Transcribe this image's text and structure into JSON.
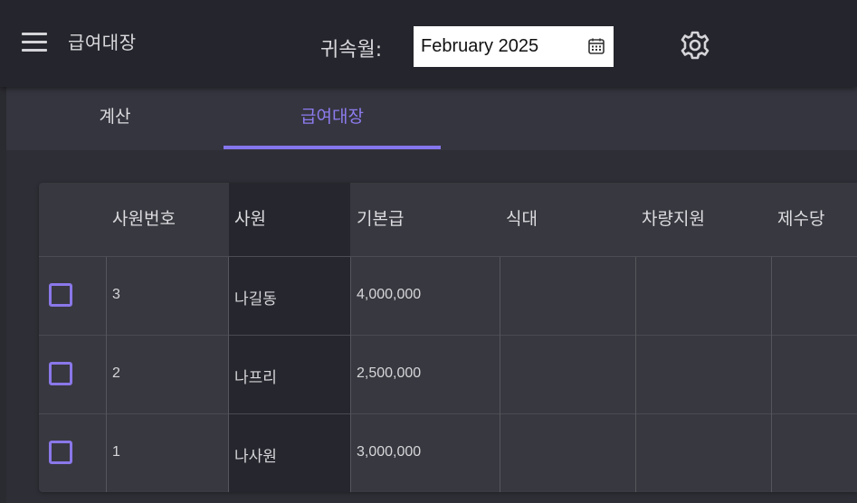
{
  "header": {
    "title": "급여대장",
    "period_label": "귀속월:",
    "period_value": "February 2025",
    "icons": {
      "menu": "menu-icon",
      "calendar": "calendar-icon",
      "settings": "gear-icon"
    }
  },
  "tabs": [
    {
      "label": "계산",
      "active": false
    },
    {
      "label": "급여대장",
      "active": true
    }
  ],
  "table": {
    "columns": [
      "사원번호",
      "사원",
      "기본급",
      "식대",
      "차량지원",
      "제수당"
    ],
    "rows": [
      {
        "id": "3",
        "name": "나길동",
        "base_pay": "4,000,000",
        "meal": "",
        "vehicle": "",
        "allowance": ""
      },
      {
        "id": "2",
        "name": "나프리",
        "base_pay": "2,500,000",
        "meal": "",
        "vehicle": "",
        "allowance": ""
      },
      {
        "id": "1",
        "name": "나사원",
        "base_pay": "3,000,000",
        "meal": "",
        "vehicle": "",
        "allowance": ""
      }
    ]
  },
  "colors": {
    "background": "#2e2e36",
    "header_bg": "#25252d",
    "accent": "#8576ee",
    "highlighted_column": "#26262e",
    "table_bg": "#383840"
  }
}
